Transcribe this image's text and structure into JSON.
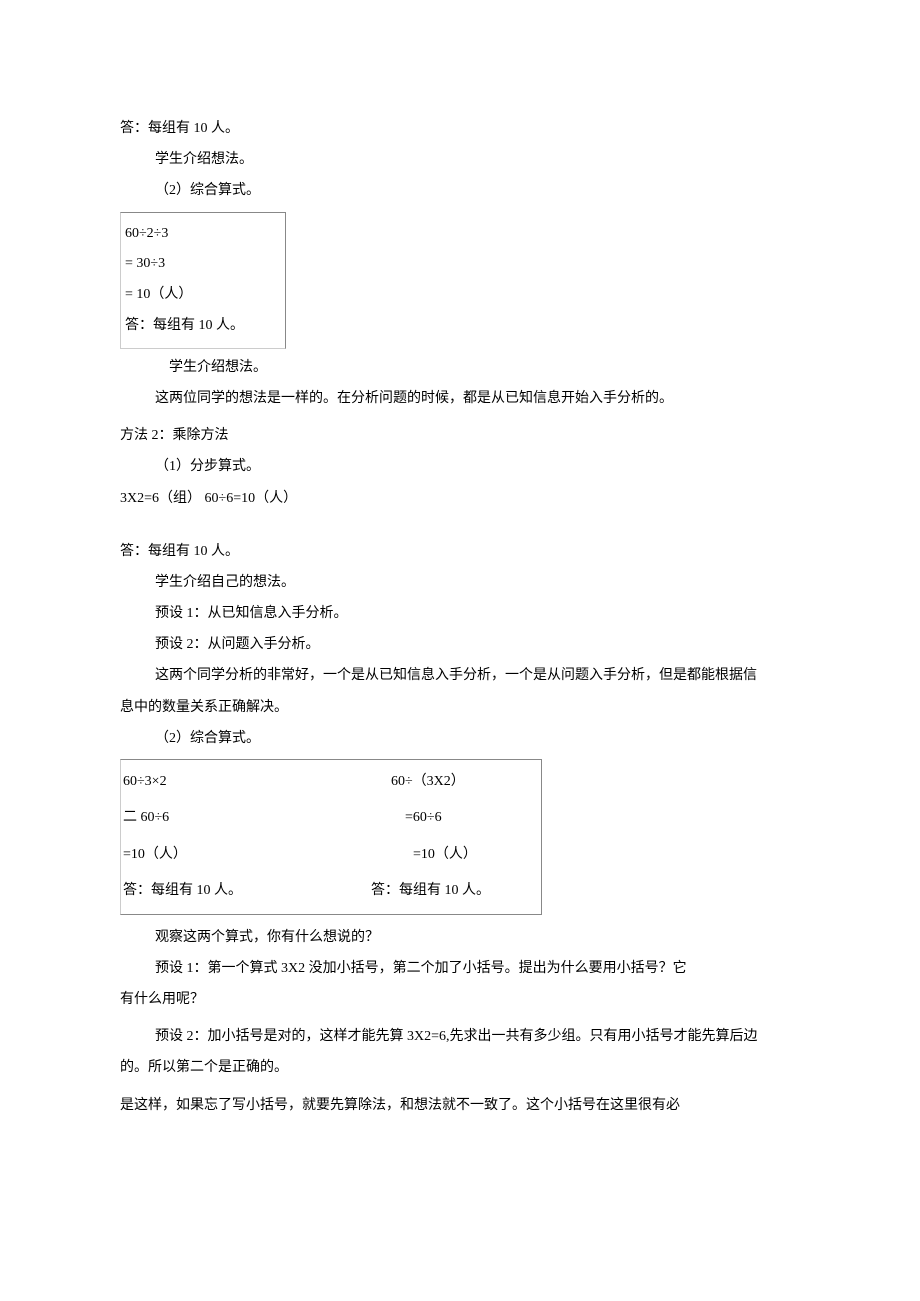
{
  "l1": "答：每组有 10 人。",
  "l2": "学生介绍想法。",
  "l3": "（2）综合算式。",
  "box1": {
    "a": "60÷2÷3",
    "b": "=  30÷3",
    "c": "=  10（人）",
    "d": "答：每组有 10 人。"
  },
  "l4": "学生介绍想法。",
  "l5": "这两位同学的想法是一样的。在分析问题的时候，都是从已知信息开始入手分析的。",
  "l6": "方法 2：乘除方法",
  "l7": "（1）分步算式。",
  "l8": "3X2=6（组）       60÷6=10（人）",
  "l9": "答：每组有 10 人。",
  "l10": "学生介绍自己的想法。",
  "l11": "预设 1：从已知信息入手分析。",
  "l12": "预设 2：从问题入手分析。",
  "l13a": "这两个同学分析的非常好，一个是从已知信息入手分析，一个是从问题入手分析，但是都能根据信",
  "l13b": "息中的数量关系正确解决。",
  "l14": "（2）综合算式。",
  "box2": {
    "r1c1": "60÷3×2",
    "r1c2": "60÷（3X2）",
    "r2c1": "二 60÷6",
    "r2c2": "=60÷6",
    "r3c1": "=10（人）",
    "r3c2": "=10（人）",
    "r4c1": "答：每组有 10 人。",
    "r4c2": "答：每组有 10 人。"
  },
  "l15": "观察这两个算式，你有什么想说的？",
  "l16": "预设 1：第一个算式 3X2 没加小括号，第二个加了小括号。提出为什么要用小括号？它",
  "l17": "有什么用呢？",
  "l18a": "预设 2：加小括号是对的，这样才能先算 3X2=6,先求出一共有多少组。只有用小括号才能先算后边",
  "l18b": "的。所以第二个是正确的。",
  "l19": "是这样，如果忘了写小括号，就要先算除法，和想法就不一致了。这个小括号在这里很有必"
}
